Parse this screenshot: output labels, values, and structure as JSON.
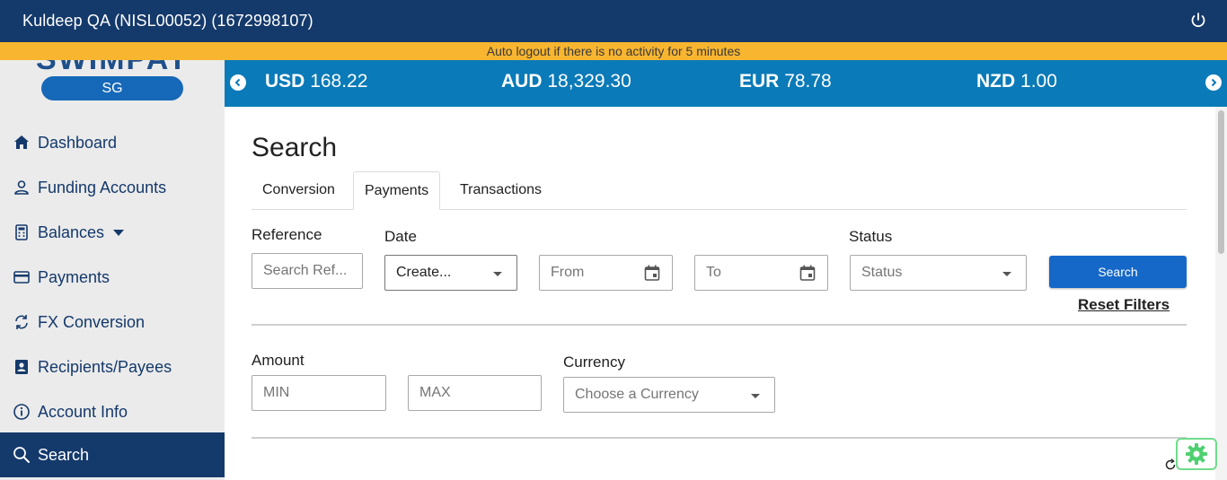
{
  "header": {
    "user_label": "Kuldeep QA (NISL00052) (1672998107)",
    "power_icon": "power-icon"
  },
  "banner": {
    "text": "Auto logout if there is no activity for 5 minutes"
  },
  "sidebar": {
    "region": "SG",
    "items": [
      {
        "label": "Dashboard",
        "icon": "home-icon"
      },
      {
        "label": "Funding Accounts",
        "icon": "person-icon"
      },
      {
        "label": "Balances",
        "icon": "calculator-icon"
      },
      {
        "label": "Payments",
        "icon": "card-icon"
      },
      {
        "label": "FX Conversion",
        "icon": "refresh-icon"
      },
      {
        "label": "Recipients/Payees",
        "icon": "contact-icon"
      },
      {
        "label": "Account Info",
        "icon": "info-icon"
      },
      {
        "label": "Search",
        "icon": "search-icon"
      }
    ]
  },
  "rates": [
    {
      "code": "USD",
      "value": "168.22"
    },
    {
      "code": "AUD",
      "value": "18,329.30"
    },
    {
      "code": "EUR",
      "value": "78.78"
    },
    {
      "code": "NZD",
      "value": "1.00"
    }
  ],
  "main": {
    "title": "Search",
    "tabs": [
      "Conversion",
      "Payments",
      "Transactions"
    ],
    "active_tab": "Payments",
    "filters": {
      "reference_label": "Reference",
      "reference_placeholder": "Search Ref...",
      "date_label": "Date",
      "date_selected": "Create...",
      "from_placeholder": "From",
      "to_placeholder": "To",
      "status_label": "Status",
      "status_placeholder": "Status",
      "search_button": "Search",
      "reset_link": "Reset Filters",
      "amount_label": "Amount",
      "min_placeholder": "MIN",
      "max_placeholder": "MAX",
      "currency_label": "Currency",
      "currency_placeholder": "Choose a Currency"
    }
  },
  "colors": {
    "header_bg": "#14396b",
    "banner_bg": "#f8b52f",
    "rates_bg": "#0a7ab8",
    "primary": "#1668c8",
    "sidebar_bg": "#ebebeb"
  }
}
